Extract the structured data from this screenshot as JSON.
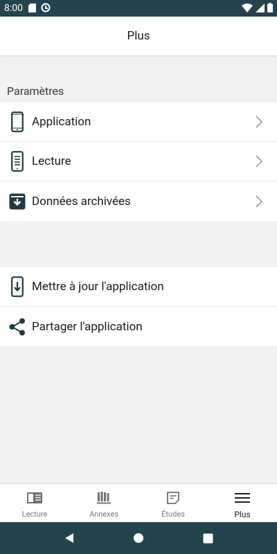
{
  "status_bar": {
    "time": "8:00",
    "icons_left": [
      "sd-card-icon",
      "sync-icon"
    ],
    "icons_right": [
      "wifi-icon",
      "signal-icon",
      "battery-icon"
    ]
  },
  "header": {
    "title": "Plus"
  },
  "settings": {
    "section_label": "Paramètres",
    "items": [
      {
        "label": "Application",
        "icon": "phone-icon"
      },
      {
        "label": "Lecture",
        "icon": "reader-icon"
      },
      {
        "label": "Données archivées",
        "icon": "archive-icon"
      }
    ]
  },
  "actions": {
    "items": [
      {
        "label": "Mettre à jour l'application",
        "icon": "update-download-icon"
      },
      {
        "label": "Partager l'application",
        "icon": "share-icon"
      }
    ]
  },
  "tabs": [
    {
      "label": "Lecture",
      "icon": "book-icon",
      "active": false
    },
    {
      "label": "Annexes",
      "icon": "library-icon",
      "active": false
    },
    {
      "label": "Études",
      "icon": "notes-icon",
      "active": false
    },
    {
      "label": "Plus",
      "icon": "menu-icon",
      "active": true
    }
  ],
  "colors": {
    "system_bar": "#23434d",
    "icon_dark": "#1e3b45",
    "tab_inactive": "#7a7a7a",
    "background": "#f2f2f2"
  }
}
